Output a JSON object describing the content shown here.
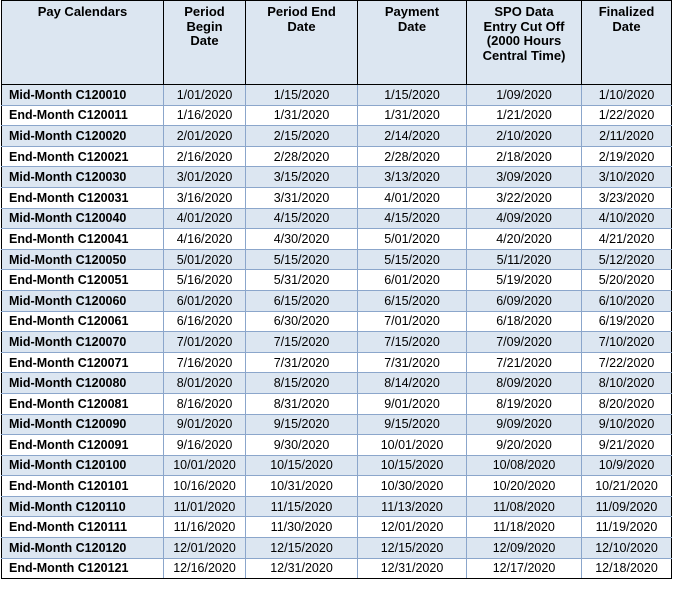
{
  "table": {
    "title": "Pay Calendars",
    "columns": [
      {
        "key": "calendar",
        "label_lines": [
          "Pay Calendars"
        ]
      },
      {
        "key": "period_begin_date",
        "label_lines": [
          "Period",
          "Begin",
          "Date"
        ]
      },
      {
        "key": "period_end_date",
        "label_lines": [
          "Period End",
          "Date"
        ]
      },
      {
        "key": "payment_date",
        "label_lines": [
          "Payment",
          "Date"
        ]
      },
      {
        "key": "spo_cutoff",
        "label_lines": [
          "SPO Data",
          "Entry Cut Off",
          "(2000 Hours",
          "Central Time)"
        ]
      },
      {
        "key": "finalized_date",
        "label_lines": [
          "Finalized",
          "Date"
        ]
      }
    ],
    "colors": {
      "header_bg": "#dce6f1",
      "row_shaded_bg": "#dce6f1",
      "row_plain_bg": "#ffffff",
      "outer_border": "#000000",
      "inner_border": "#8ba6cb",
      "text": "#000000"
    },
    "rows": [
      {
        "calendar": "Mid-Month C120010",
        "period_begin_date": "1/01/2020",
        "period_end_date": "1/15/2020",
        "payment_date": "1/15/2020",
        "spo_cutoff": "1/09/2020",
        "finalized_date": "1/10/2020",
        "shaded": true
      },
      {
        "calendar": "End-Month C120011",
        "period_begin_date": "1/16/2020",
        "period_end_date": "1/31/2020",
        "payment_date": "1/31/2020",
        "spo_cutoff": "1/21/2020",
        "finalized_date": "1/22/2020",
        "shaded": false
      },
      {
        "calendar": "Mid-Month C120020",
        "period_begin_date": "2/01/2020",
        "period_end_date": "2/15/2020",
        "payment_date": "2/14/2020",
        "spo_cutoff": "2/10/2020",
        "finalized_date": "2/11/2020",
        "shaded": true
      },
      {
        "calendar": "End-Month C120021",
        "period_begin_date": "2/16/2020",
        "period_end_date": "2/28/2020",
        "payment_date": "2/28/2020",
        "spo_cutoff": "2/18/2020",
        "finalized_date": "2/19/2020",
        "shaded": false
      },
      {
        "calendar": "Mid-Month C120030",
        "period_begin_date": "3/01/2020",
        "period_end_date": "3/15/2020",
        "payment_date": "3/13/2020",
        "spo_cutoff": "3/09/2020",
        "finalized_date": "3/10/2020",
        "shaded": true
      },
      {
        "calendar": "End-Month C120031",
        "period_begin_date": "3/16/2020",
        "period_end_date": "3/31/2020",
        "payment_date": "4/01/2020",
        "spo_cutoff": "3/22/2020",
        "finalized_date": "3/23/2020",
        "shaded": false
      },
      {
        "calendar": "Mid-Month C120040",
        "period_begin_date": "4/01/2020",
        "period_end_date": "4/15/2020",
        "payment_date": "4/15/2020",
        "spo_cutoff": "4/09/2020",
        "finalized_date": "4/10/2020",
        "shaded": true
      },
      {
        "calendar": "End-Month C120041",
        "period_begin_date": "4/16/2020",
        "period_end_date": "4/30/2020",
        "payment_date": "5/01/2020",
        "spo_cutoff": "4/20/2020",
        "finalized_date": "4/21/2020",
        "shaded": false
      },
      {
        "calendar": "Mid-Month C120050",
        "period_begin_date": "5/01/2020",
        "period_end_date": "5/15/2020",
        "payment_date": "5/15/2020",
        "spo_cutoff": "5/11/2020",
        "finalized_date": "5/12/2020",
        "shaded": true
      },
      {
        "calendar": "End-Month C120051",
        "period_begin_date": "5/16/2020",
        "period_end_date": "5/31/2020",
        "payment_date": "6/01/2020",
        "spo_cutoff": "5/19/2020",
        "finalized_date": "5/20/2020",
        "shaded": false
      },
      {
        "calendar": "Mid-Month C120060",
        "period_begin_date": "6/01/2020",
        "period_end_date": "6/15/2020",
        "payment_date": "6/15/2020",
        "spo_cutoff": "6/09/2020",
        "finalized_date": "6/10/2020",
        "shaded": true
      },
      {
        "calendar": "End-Month C120061",
        "period_begin_date": "6/16/2020",
        "period_end_date": "6/30/2020",
        "payment_date": "7/01/2020",
        "spo_cutoff": "6/18/2020",
        "finalized_date": "6/19/2020",
        "shaded": false
      },
      {
        "calendar": "Mid-Month C120070",
        "period_begin_date": "7/01/2020",
        "period_end_date": "7/15/2020",
        "payment_date": "7/15/2020",
        "spo_cutoff": "7/09/2020",
        "finalized_date": "7/10/2020",
        "shaded": true
      },
      {
        "calendar": "End-Month C120071",
        "period_begin_date": "7/16/2020",
        "period_end_date": "7/31/2020",
        "payment_date": "7/31/2020",
        "spo_cutoff": "7/21/2020",
        "finalized_date": "7/22/2020",
        "shaded": false
      },
      {
        "calendar": "Mid-Month C120080",
        "period_begin_date": "8/01/2020",
        "period_end_date": "8/15/2020",
        "payment_date": "8/14/2020",
        "spo_cutoff": "8/09/2020",
        "finalized_date": "8/10/2020",
        "shaded": true
      },
      {
        "calendar": "End-Month C120081",
        "period_begin_date": "8/16/2020",
        "period_end_date": "8/31/2020",
        "payment_date": "9/01/2020",
        "spo_cutoff": "8/19/2020",
        "finalized_date": "8/20/2020",
        "shaded": false
      },
      {
        "calendar": "Mid-Month C120090",
        "period_begin_date": "9/01/2020",
        "period_end_date": "9/15/2020",
        "payment_date": "9/15/2020",
        "spo_cutoff": "9/09/2020",
        "finalized_date": "9/10/2020",
        "shaded": true
      },
      {
        "calendar": "End-Month C120091",
        "period_begin_date": "9/16/2020",
        "period_end_date": "9/30/2020",
        "payment_date": "10/01/2020",
        "spo_cutoff": "9/20/2020",
        "finalized_date": "9/21/2020",
        "shaded": false
      },
      {
        "calendar": "Mid-Month C120100",
        "period_begin_date": "10/01/2020",
        "period_end_date": "10/15/2020",
        "payment_date": "10/15/2020",
        "spo_cutoff": "10/08/2020",
        "finalized_date": "10/9/2020",
        "shaded": true
      },
      {
        "calendar": "End-Month C120101",
        "period_begin_date": "10/16/2020",
        "period_end_date": "10/31/2020",
        "payment_date": "10/30/2020",
        "spo_cutoff": "10/20/2020",
        "finalized_date": "10/21/2020",
        "shaded": false
      },
      {
        "calendar": "Mid-Month C120110",
        "period_begin_date": "11/01/2020",
        "period_end_date": "11/15/2020",
        "payment_date": "11/13/2020",
        "spo_cutoff": "11/08/2020",
        "finalized_date": "11/09/2020",
        "shaded": true
      },
      {
        "calendar": "End-Month C120111",
        "period_begin_date": "11/16/2020",
        "period_end_date": "11/30/2020",
        "payment_date": "12/01/2020",
        "spo_cutoff": "11/18/2020",
        "finalized_date": "11/19/2020",
        "shaded": false
      },
      {
        "calendar": "Mid-Month C120120",
        "period_begin_date": "12/01/2020",
        "period_end_date": "12/15/2020",
        "payment_date": "12/15/2020",
        "spo_cutoff": "12/09/2020",
        "finalized_date": "12/10/2020",
        "shaded": true
      },
      {
        "calendar": "End-Month C120121",
        "period_begin_date": "12/16/2020",
        "period_end_date": "12/31/2020",
        "payment_date": "12/31/2020",
        "spo_cutoff": "12/17/2020",
        "finalized_date": "12/18/2020",
        "shaded": false
      }
    ]
  }
}
